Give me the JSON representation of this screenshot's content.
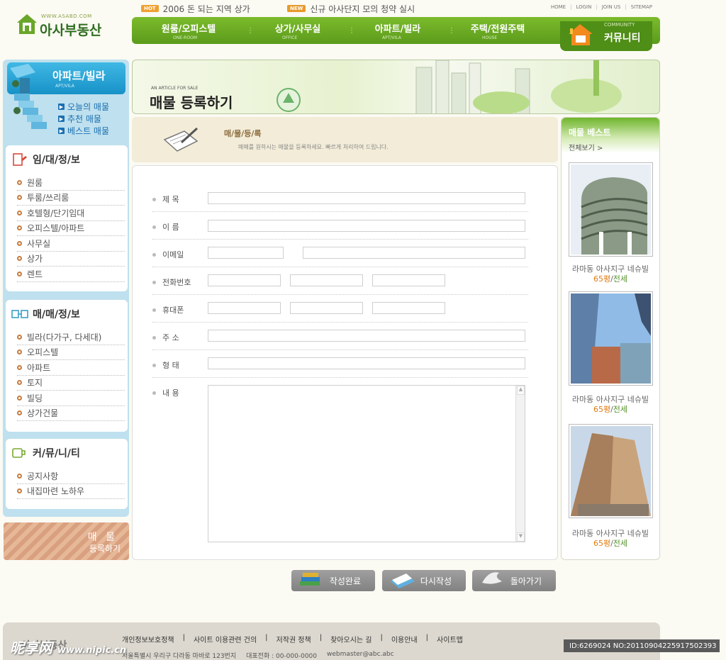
{
  "site": {
    "logo_url_text": "WWW.ASABD.COM",
    "logo_name": "아사부동산"
  },
  "news": [
    {
      "badge": "HOT",
      "text": "2006 돈 되는 지역 상가"
    },
    {
      "badge": "NEW",
      "text": "신규 아사단지 모의 청약 실시"
    }
  ],
  "top_links": [
    "HOME",
    "LOGIN",
    "JOIN US",
    "SITEMAP"
  ],
  "gnb": [
    {
      "label": "원룸/오피스텔",
      "sub": "ONE-ROOM"
    },
    {
      "label": "상가/사무실",
      "sub": "OFFICE"
    },
    {
      "label": "아파트/빌라",
      "sub": "APT/VILA"
    },
    {
      "label": "주택/전원주택",
      "sub": "HOUSE"
    }
  ],
  "community": {
    "sub": "COMMUNITY",
    "label": "커뮤니티"
  },
  "sidebar": {
    "banner_title": "아파트/빌라",
    "banner_sub": "APT/VILA",
    "banner_links": [
      "오늘의 매물",
      "추천 매물",
      "베스트 매물"
    ],
    "sections": [
      {
        "title": "임/대/정/보",
        "items": [
          "원룸",
          "투룸/쓰리룸",
          "호텔형/단기임대",
          "오피스텔/아파트",
          "사무실",
          "상가",
          "렌트"
        ]
      },
      {
        "title": "매/매/정/보",
        "items": [
          "빌라(다가구, 다세대)",
          "오피스텔",
          "아파트",
          "토지",
          "빌딩",
          "상가건물"
        ]
      },
      {
        "title": "커/뮤/니/티",
        "items": [
          "공지사항",
          "내집마련 노하우"
        ]
      }
    ],
    "bottom_banner": {
      "line1": "매 물",
      "line2": "등록하기"
    }
  },
  "main_banner": {
    "sub": "AN ARTICLE FOR SALE",
    "title": "매물 등록하기"
  },
  "content_head": {
    "title": "매/물/등/록",
    "desc": "매매를 원하시는 매물을 등록하세요. 빠르게 처리하여 드립니다."
  },
  "form_labels": [
    "제 목",
    "이 름",
    "이메일",
    "전화번호",
    "휴대폰",
    "주 소",
    "형 태",
    "내 용"
  ],
  "right_box": {
    "title": "매물 베스트",
    "more": "전체보기 >",
    "items": [
      {
        "name": "라마동 아사지구 네슈빌",
        "size": "65평",
        "sep": "/",
        "type": "전세"
      },
      {
        "name": "라마동 아사지구 네슈빌",
        "size": "65평",
        "sep": "/",
        "type": "전세"
      },
      {
        "name": "라마동 아사지구 네슈빌",
        "size": "65평",
        "sep": "/",
        "type": "전세"
      }
    ]
  },
  "buttons": {
    "submit": "작성완료",
    "reset": "다시작성",
    "back": "돌아가기"
  },
  "footer": {
    "links": [
      "개인정보보호정책",
      "사이트 이용관련 건의",
      "저작권 정책",
      "찾아오시는 길",
      "이용안내",
      "사이트맵"
    ],
    "address": "서울특별시 우리구 다라동 마바로 123번지",
    "phone": "대표전화 : 00-000-0000",
    "email": "webmaster@abc.abc",
    "logo": "아사부동산"
  },
  "watermark": {
    "left_big": "昵享网",
    "left_small": "www.nipic.cn",
    "right": "ID:6269024 NO:20110904225917502393"
  },
  "colors": {
    "green": "#5b9b1b",
    "sky": "#bfe0ee",
    "accent_orange": "#e07a10"
  }
}
